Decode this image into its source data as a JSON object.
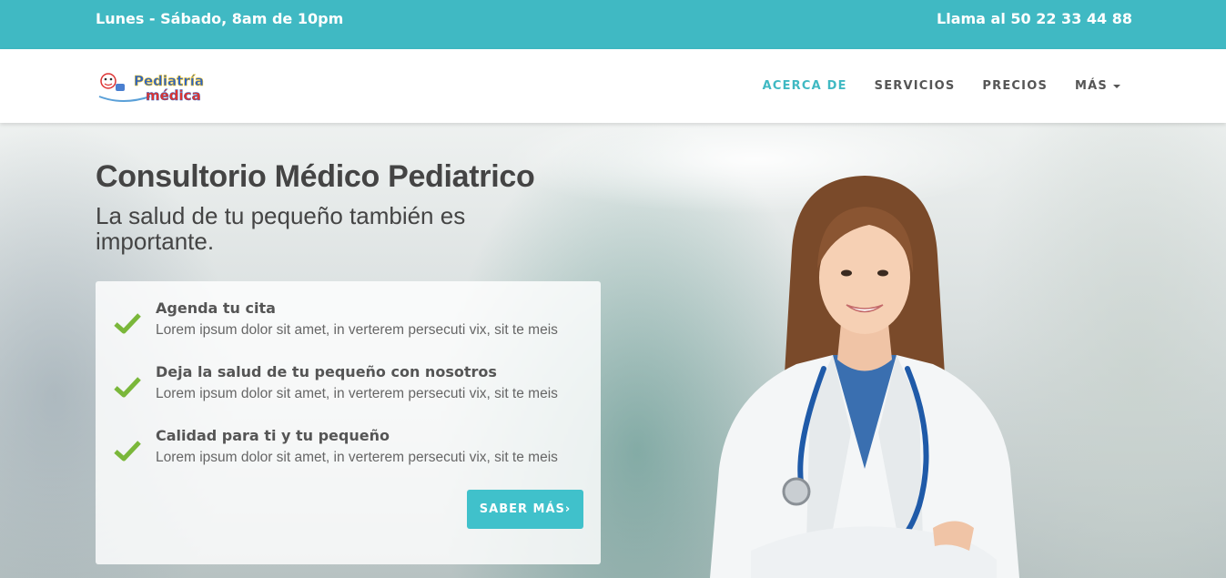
{
  "topbar": {
    "hours": "Lunes - Sábado, 8am de 10pm",
    "phone": "Llama al 50 22 33 44 88"
  },
  "logo": {
    "line1": "Pediatría",
    "line2": "médica"
  },
  "nav": {
    "items": [
      {
        "label": "ACERCA DE",
        "active": true
      },
      {
        "label": "SERVICIOS"
      },
      {
        "label": "PRECIOS"
      },
      {
        "label": "MÁS",
        "dropdown": true
      }
    ]
  },
  "hero": {
    "title": "Consultorio Médico Pediatrico",
    "subtitle": "La salud de tu pequeño también es importante.",
    "features": [
      {
        "title": "Agenda tu cita",
        "desc": "Lorem ipsum dolor sit amet, in verterem persecuti vix, sit te meis",
        "icon": "check-icon"
      },
      {
        "title": "Deja la salud de tu pequeño con nosotros",
        "desc": "Lorem ipsum dolor sit amet, in verterem persecuti vix, sit te meis",
        "icon": "check-icon"
      },
      {
        "title": "Calidad para ti y tu pequeño",
        "desc": "Lorem ipsum dolor sit amet, in verterem persecuti vix, sit te meis",
        "icon": "check-icon"
      }
    ],
    "button_label": "SABER MÁS›"
  },
  "colors": {
    "accent": "#40b9c3",
    "check": "#7ab73a",
    "text": "#444444"
  }
}
